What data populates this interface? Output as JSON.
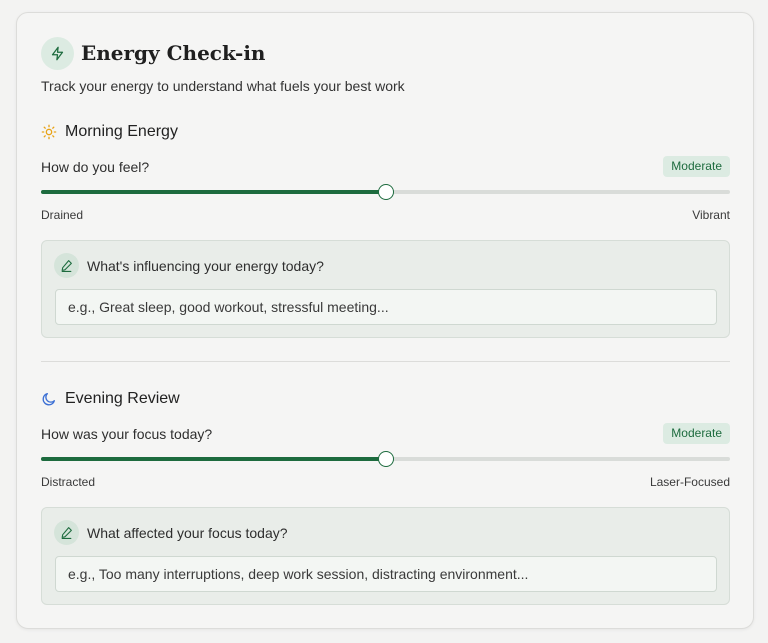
{
  "header": {
    "icon": "lightning-bolt-icon",
    "title": "Energy Check-in",
    "subtitle": "Track your energy to understand what fuels your best work"
  },
  "morning": {
    "icon": "sun-icon",
    "title": "Morning Energy",
    "question": "How do you feel?",
    "badge": "Moderate",
    "slider_value_fraction": 0.5,
    "min_label": "Drained",
    "max_label": "Vibrant",
    "note_icon": "pencil-icon",
    "note_prompt": "What's influencing your energy today?",
    "note_placeholder": "e.g., Great sleep, good workout, stressful meeting...",
    "note_value": ""
  },
  "evening": {
    "icon": "moon-icon",
    "title": "Evening Review",
    "question": "How was your focus today?",
    "badge": "Moderate",
    "slider_value_fraction": 0.5,
    "min_label": "Distracted",
    "max_label": "Laser-Focused",
    "note_icon": "pencil-icon",
    "note_prompt": "What affected your focus today?",
    "note_placeholder": "e.g., Too many interruptions, deep work session, distracting environment...",
    "note_value": ""
  },
  "colors": {
    "accent": "#1d6b3e",
    "accent_soft": "#dcebe2",
    "sun": "#e8a317",
    "moon": "#3b6fd4"
  }
}
